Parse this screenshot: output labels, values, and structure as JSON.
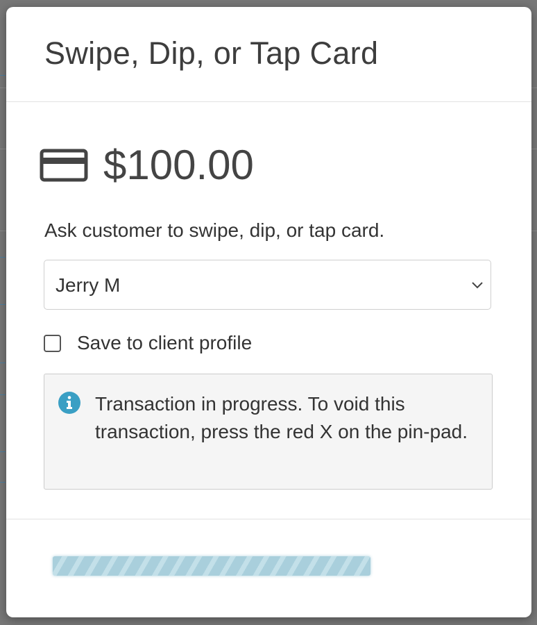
{
  "modal": {
    "title": "Swipe, Dip, or Tap Card",
    "amount": "$100.00",
    "card_icon": "credit-card-icon",
    "instruction": "Ask customer to swipe, dip, or tap card.",
    "device_select": {
      "value": "Jerry M",
      "icon": "chevron-down-icon"
    },
    "save_checkbox": {
      "label": "Save to client profile",
      "checked": false
    },
    "info": {
      "icon": "info-icon",
      "text": "Transaction in progress. To void this transaction, press the red X on the pin-pad.",
      "icon_color": "#3a9fc4"
    },
    "progress": {
      "status": "indeterminate",
      "color": "#a9cfdc"
    }
  }
}
